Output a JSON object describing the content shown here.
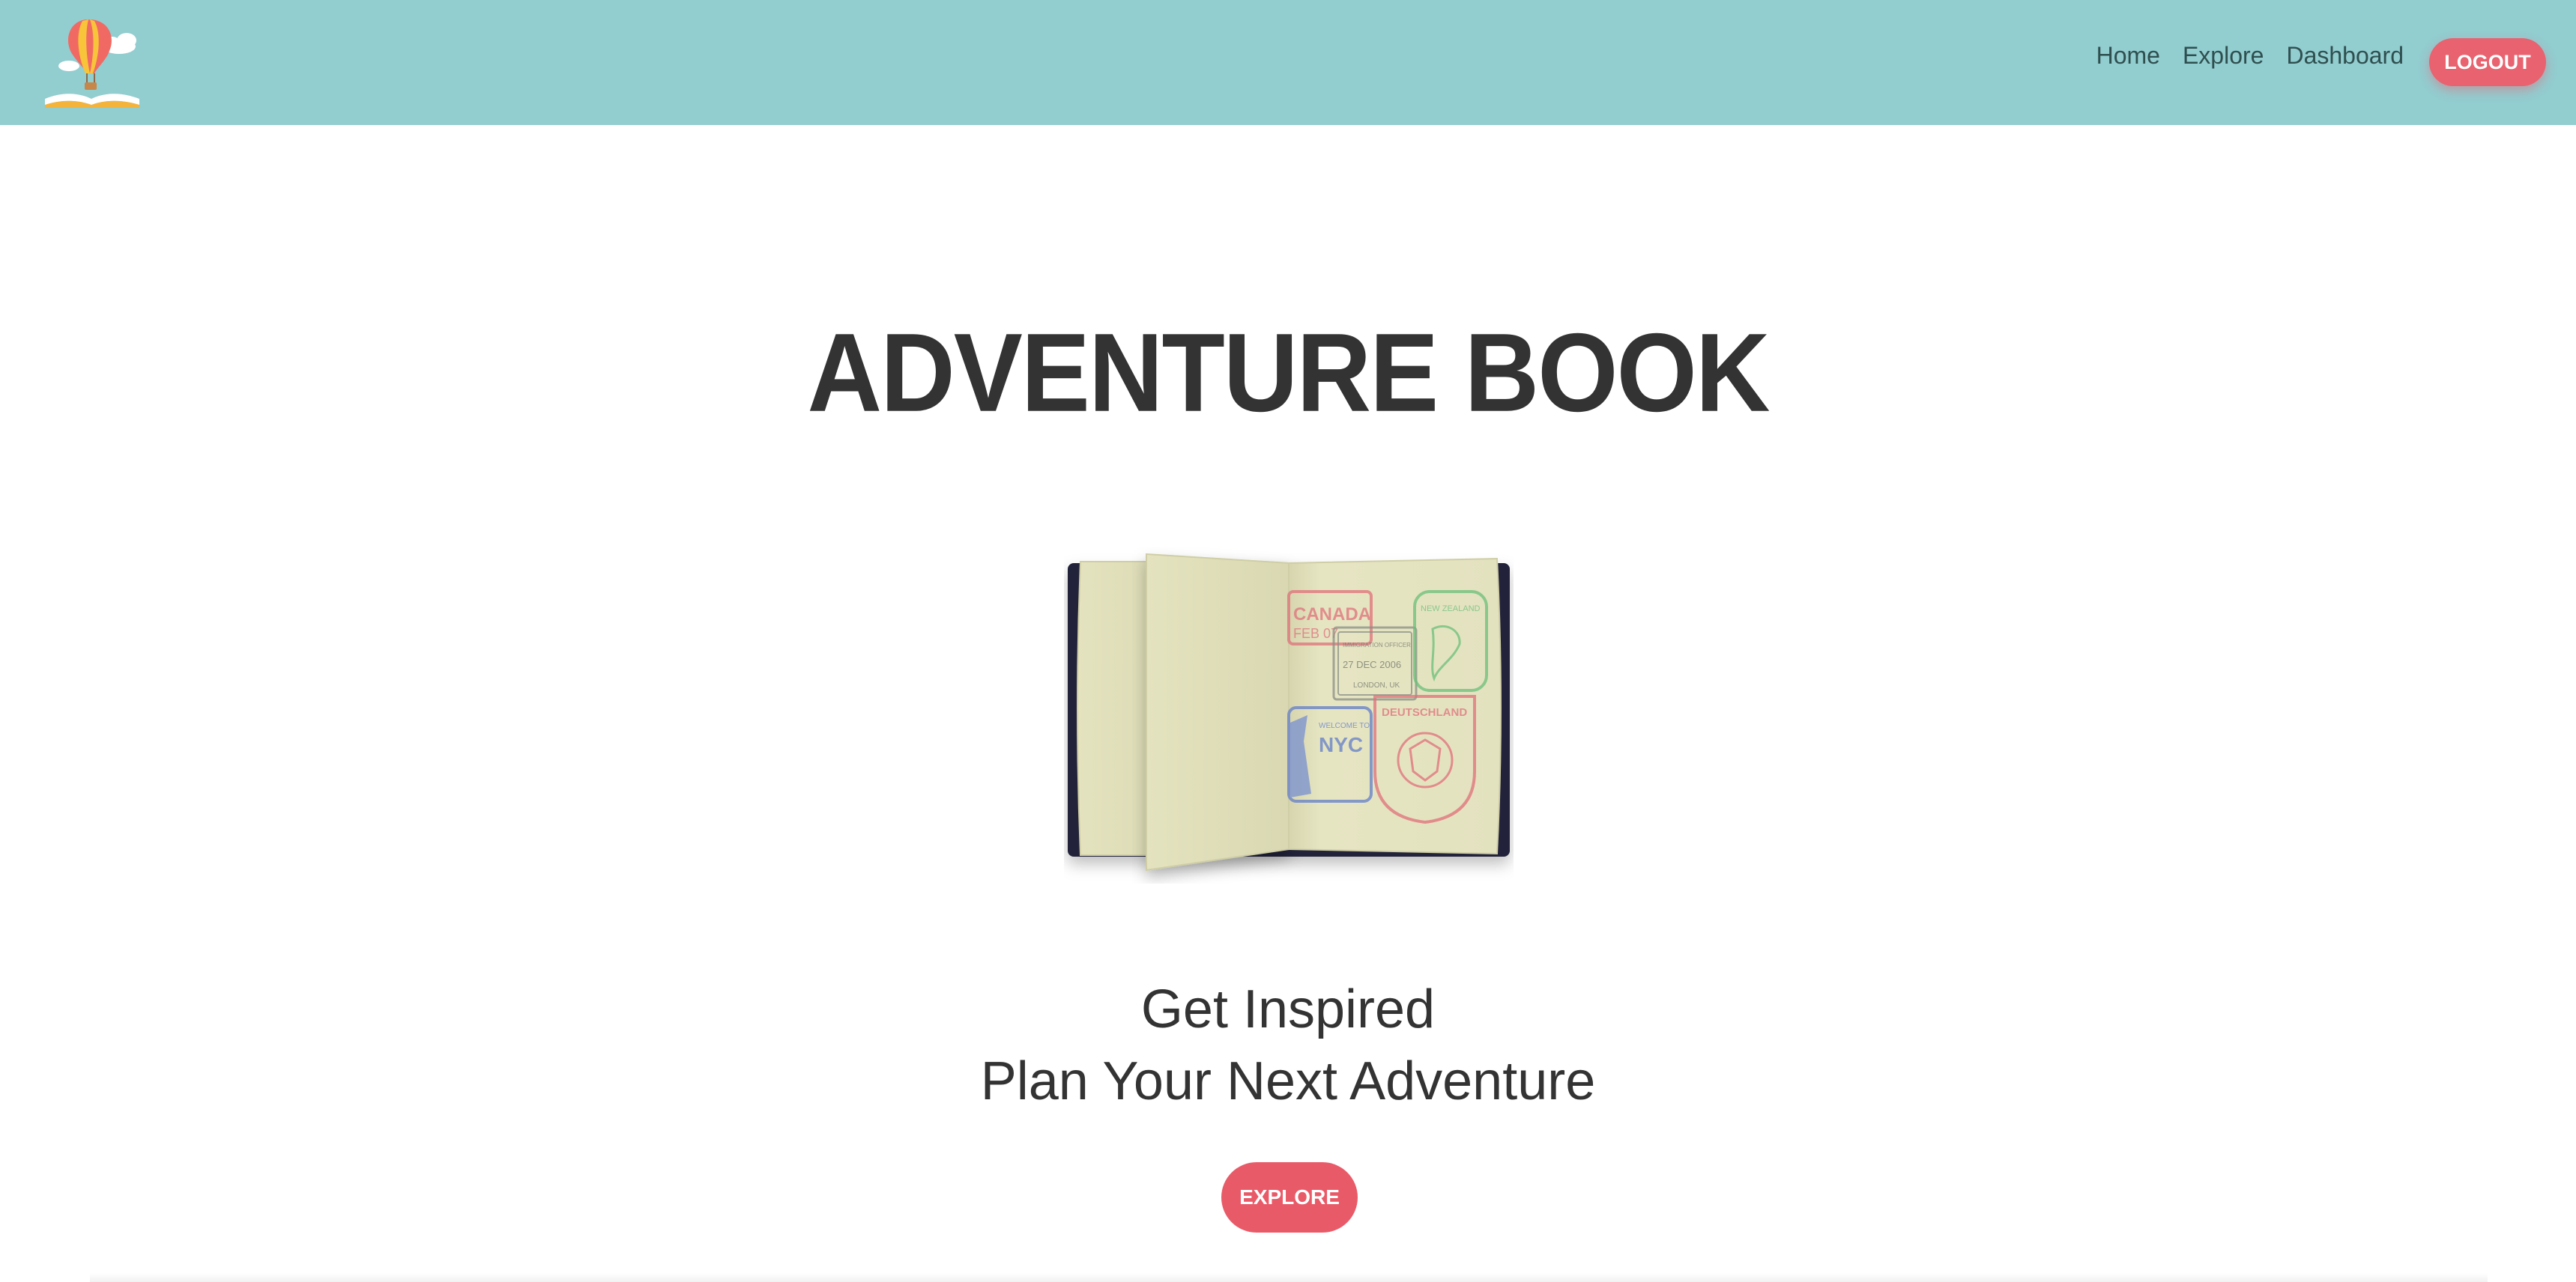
{
  "navbar": {
    "logo_icon": "hot-air-balloon-book-logo",
    "links": [
      "Home",
      "Explore",
      "Dashboard"
    ],
    "logout_label": "LOGOUT"
  },
  "hero": {
    "title": "ADVENTURE BOOK",
    "image_icon": "open-passport-with-stamps",
    "stamp_texts": [
      "CANADA",
      "FEB 07",
      "IMMIGRATION OFFICER",
      "27 DEC 2006",
      "LONDON, UK",
      "NEW ZEALAND",
      "WELCOME TO",
      "NYC",
      "DEUTSCHLAND"
    ],
    "tagline_line1": "Get Inspired",
    "tagline_line2": "Plan Your Next Adventure",
    "explore_label": "EXPLORE"
  },
  "colors": {
    "navbar_bg": "#92cdd0",
    "accent": "#e95a68",
    "text": "#333333"
  }
}
